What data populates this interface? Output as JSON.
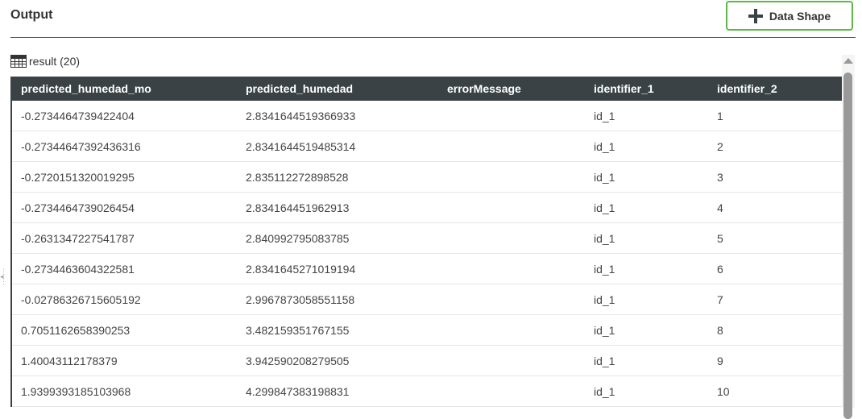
{
  "header": {
    "title": "Output",
    "add_button_label": "Data Shape"
  },
  "result": {
    "label": "result (20)"
  },
  "table": {
    "columns": [
      "predicted_humedad_mo",
      "predicted_humedad",
      "errorMessage",
      "identifier_1",
      "identifier_2"
    ],
    "rows": [
      [
        "-0.2734464739422404",
        "2.8341644519366933",
        "",
        "id_1",
        "1"
      ],
      [
        "-0.27344647392436316",
        "2.8341644519485314",
        "",
        "id_1",
        "2"
      ],
      [
        "-0.2720151320019295",
        "2.835112272898528",
        "",
        "id_1",
        "3"
      ],
      [
        "-0.2734464739026454",
        "2.834164451962913",
        "",
        "id_1",
        "4"
      ],
      [
        "-0.2631347227541787",
        "2.840992795083785",
        "",
        "id_1",
        "5"
      ],
      [
        "-0.2734463604322581",
        "2.8341645271019194",
        "",
        "id_1",
        "6"
      ],
      [
        "-0.02786326715605192",
        "2.9967873058551158",
        "",
        "id_1",
        "7"
      ],
      [
        "0.7051162658390253",
        "3.482159351767155",
        "",
        "id_1",
        "8"
      ],
      [
        "1.40043112178379",
        "3.942590208279505",
        "",
        "id_1",
        "9"
      ],
      [
        "1.9399393185103968",
        "4.299847383198831",
        "",
        "id_1",
        "10"
      ]
    ]
  },
  "colors": {
    "accent": "#5cb946",
    "header_bg": "#3a4245"
  }
}
